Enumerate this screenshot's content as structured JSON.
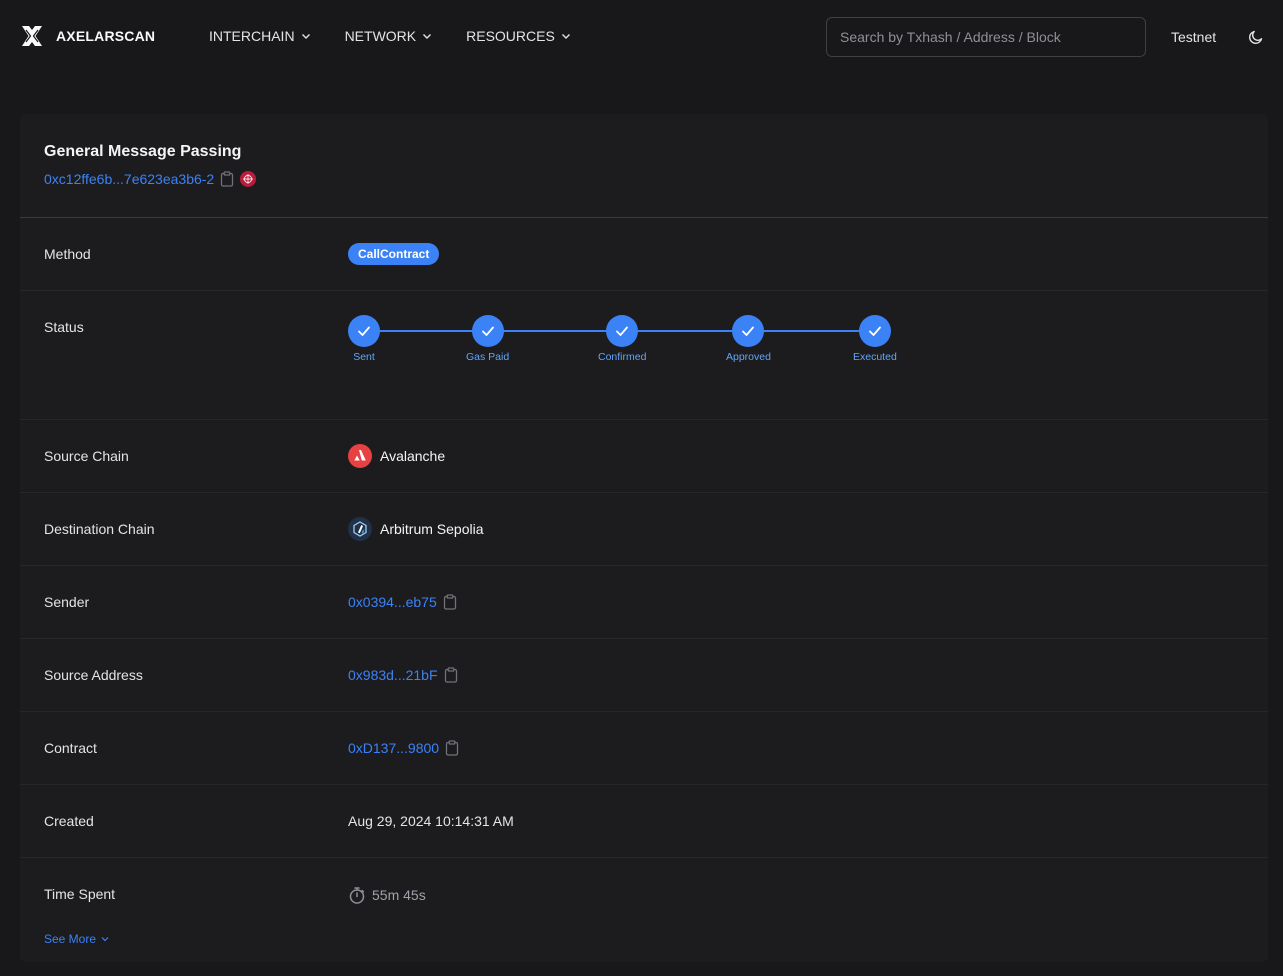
{
  "header": {
    "brand": "AXELARSCAN",
    "nav": [
      {
        "label": "INTERCHAIN"
      },
      {
        "label": "NETWORK"
      },
      {
        "label": "RESOURCES"
      }
    ],
    "search_placeholder": "Search by Txhash / Address / Block",
    "network": "Testnet",
    "theme_icon": "moon-icon"
  },
  "card": {
    "title": "General Message Passing",
    "tx_hash": "0xc12ffe6b...7e623ea3b6-2"
  },
  "rows": {
    "method": {
      "label": "Method",
      "value": "CallContract"
    },
    "status": {
      "label": "Status",
      "steps": [
        "Sent",
        "Gas Paid",
        "Confirmed",
        "Approved",
        "Executed"
      ]
    },
    "source_chain": {
      "label": "Source Chain",
      "value": "Avalanche"
    },
    "destination_chain": {
      "label": "Destination Chain",
      "value": "Arbitrum Sepolia"
    },
    "sender": {
      "label": "Sender",
      "value": "0x0394...eb75"
    },
    "source_address": {
      "label": "Source Address",
      "value": "0x983d...21bF"
    },
    "contract": {
      "label": "Contract",
      "value": "0xD137...9800"
    },
    "created": {
      "label": "Created",
      "value": "Aug 29, 2024 10:14:31 AM"
    },
    "time_spent": {
      "label": "Time Spent",
      "value": "55m 45s"
    }
  },
  "see_more": "See More",
  "colors": {
    "accent": "#3b82f6",
    "background": "#18181b",
    "card": "#1c1c1f",
    "avalanche": "#e84142"
  }
}
